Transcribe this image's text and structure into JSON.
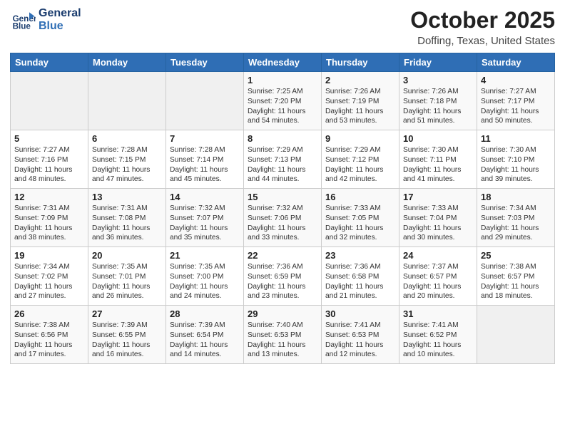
{
  "header": {
    "logo_line1": "General",
    "logo_line2": "Blue",
    "title": "October 2025",
    "subtitle": "Doffing, Texas, United States"
  },
  "days_of_week": [
    "Sunday",
    "Monday",
    "Tuesday",
    "Wednesday",
    "Thursday",
    "Friday",
    "Saturday"
  ],
  "weeks": [
    [
      {
        "num": "",
        "info": ""
      },
      {
        "num": "",
        "info": ""
      },
      {
        "num": "",
        "info": ""
      },
      {
        "num": "1",
        "info": "Sunrise: 7:25 AM\nSunset: 7:20 PM\nDaylight: 11 hours and 54 minutes."
      },
      {
        "num": "2",
        "info": "Sunrise: 7:26 AM\nSunset: 7:19 PM\nDaylight: 11 hours and 53 minutes."
      },
      {
        "num": "3",
        "info": "Sunrise: 7:26 AM\nSunset: 7:18 PM\nDaylight: 11 hours and 51 minutes."
      },
      {
        "num": "4",
        "info": "Sunrise: 7:27 AM\nSunset: 7:17 PM\nDaylight: 11 hours and 50 minutes."
      }
    ],
    [
      {
        "num": "5",
        "info": "Sunrise: 7:27 AM\nSunset: 7:16 PM\nDaylight: 11 hours and 48 minutes."
      },
      {
        "num": "6",
        "info": "Sunrise: 7:28 AM\nSunset: 7:15 PM\nDaylight: 11 hours and 47 minutes."
      },
      {
        "num": "7",
        "info": "Sunrise: 7:28 AM\nSunset: 7:14 PM\nDaylight: 11 hours and 45 minutes."
      },
      {
        "num": "8",
        "info": "Sunrise: 7:29 AM\nSunset: 7:13 PM\nDaylight: 11 hours and 44 minutes."
      },
      {
        "num": "9",
        "info": "Sunrise: 7:29 AM\nSunset: 7:12 PM\nDaylight: 11 hours and 42 minutes."
      },
      {
        "num": "10",
        "info": "Sunrise: 7:30 AM\nSunset: 7:11 PM\nDaylight: 11 hours and 41 minutes."
      },
      {
        "num": "11",
        "info": "Sunrise: 7:30 AM\nSunset: 7:10 PM\nDaylight: 11 hours and 39 minutes."
      }
    ],
    [
      {
        "num": "12",
        "info": "Sunrise: 7:31 AM\nSunset: 7:09 PM\nDaylight: 11 hours and 38 minutes."
      },
      {
        "num": "13",
        "info": "Sunrise: 7:31 AM\nSunset: 7:08 PM\nDaylight: 11 hours and 36 minutes."
      },
      {
        "num": "14",
        "info": "Sunrise: 7:32 AM\nSunset: 7:07 PM\nDaylight: 11 hours and 35 minutes."
      },
      {
        "num": "15",
        "info": "Sunrise: 7:32 AM\nSunset: 7:06 PM\nDaylight: 11 hours and 33 minutes."
      },
      {
        "num": "16",
        "info": "Sunrise: 7:33 AM\nSunset: 7:05 PM\nDaylight: 11 hours and 32 minutes."
      },
      {
        "num": "17",
        "info": "Sunrise: 7:33 AM\nSunset: 7:04 PM\nDaylight: 11 hours and 30 minutes."
      },
      {
        "num": "18",
        "info": "Sunrise: 7:34 AM\nSunset: 7:03 PM\nDaylight: 11 hours and 29 minutes."
      }
    ],
    [
      {
        "num": "19",
        "info": "Sunrise: 7:34 AM\nSunset: 7:02 PM\nDaylight: 11 hours and 27 minutes."
      },
      {
        "num": "20",
        "info": "Sunrise: 7:35 AM\nSunset: 7:01 PM\nDaylight: 11 hours and 26 minutes."
      },
      {
        "num": "21",
        "info": "Sunrise: 7:35 AM\nSunset: 7:00 PM\nDaylight: 11 hours and 24 minutes."
      },
      {
        "num": "22",
        "info": "Sunrise: 7:36 AM\nSunset: 6:59 PM\nDaylight: 11 hours and 23 minutes."
      },
      {
        "num": "23",
        "info": "Sunrise: 7:36 AM\nSunset: 6:58 PM\nDaylight: 11 hours and 21 minutes."
      },
      {
        "num": "24",
        "info": "Sunrise: 7:37 AM\nSunset: 6:57 PM\nDaylight: 11 hours and 20 minutes."
      },
      {
        "num": "25",
        "info": "Sunrise: 7:38 AM\nSunset: 6:57 PM\nDaylight: 11 hours and 18 minutes."
      }
    ],
    [
      {
        "num": "26",
        "info": "Sunrise: 7:38 AM\nSunset: 6:56 PM\nDaylight: 11 hours and 17 minutes."
      },
      {
        "num": "27",
        "info": "Sunrise: 7:39 AM\nSunset: 6:55 PM\nDaylight: 11 hours and 16 minutes."
      },
      {
        "num": "28",
        "info": "Sunrise: 7:39 AM\nSunset: 6:54 PM\nDaylight: 11 hours and 14 minutes."
      },
      {
        "num": "29",
        "info": "Sunrise: 7:40 AM\nSunset: 6:53 PM\nDaylight: 11 hours and 13 minutes."
      },
      {
        "num": "30",
        "info": "Sunrise: 7:41 AM\nSunset: 6:53 PM\nDaylight: 11 hours and 12 minutes."
      },
      {
        "num": "31",
        "info": "Sunrise: 7:41 AM\nSunset: 6:52 PM\nDaylight: 11 hours and 10 minutes."
      },
      {
        "num": "",
        "info": ""
      }
    ]
  ]
}
